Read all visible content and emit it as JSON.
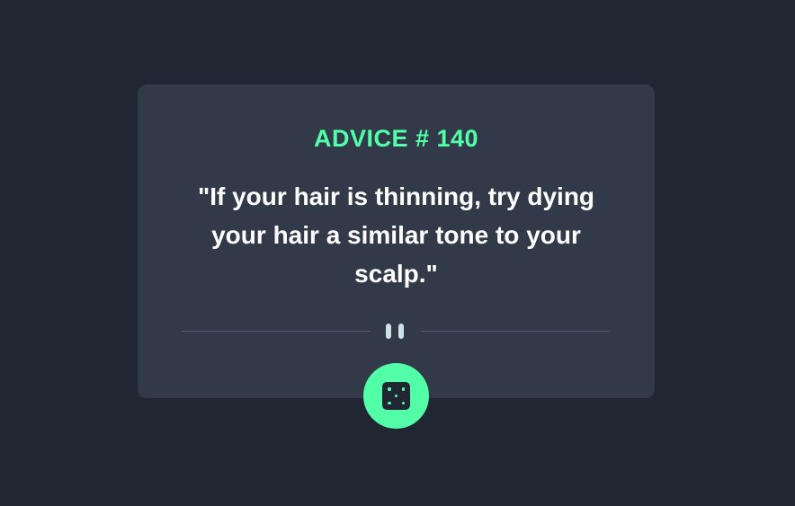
{
  "card": {
    "advice_id": "ADVICE # 140",
    "quote": "\"If your hair is thinning, try dying your hair a similar tone to your scalp.\""
  },
  "divider": {
    "icon": "pause-icon"
  },
  "button": {
    "icon": "dice-icon",
    "color": "#52ffa8"
  },
  "colors": {
    "background": "#202632",
    "card": "#323a49",
    "accent": "#52ffa8",
    "text": "#ffffff"
  }
}
